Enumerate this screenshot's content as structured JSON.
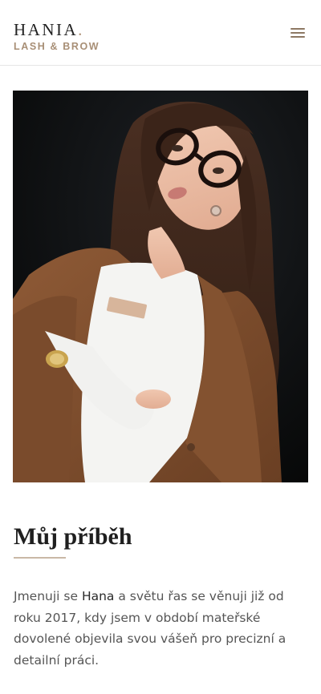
{
  "header": {
    "brand_name": "HANIA",
    "brand_dot": ".",
    "brand_tagline": "LASH & BROW",
    "menu_icon": "hamburger-menu-icon"
  },
  "colors": {
    "accent": "#a88f76",
    "text": "#555555",
    "heading": "#1f1f1f"
  },
  "hero": {
    "image": "portrait-photo"
  },
  "story": {
    "title": "Můj příběh",
    "intro": "Jmenuji se ",
    "name": "Hana",
    "body": " a světu řas se věnuji již od roku 2017, kdy jsem v období mateřské dovolené objevila svou vášeň pro precizní a detailní práci."
  }
}
